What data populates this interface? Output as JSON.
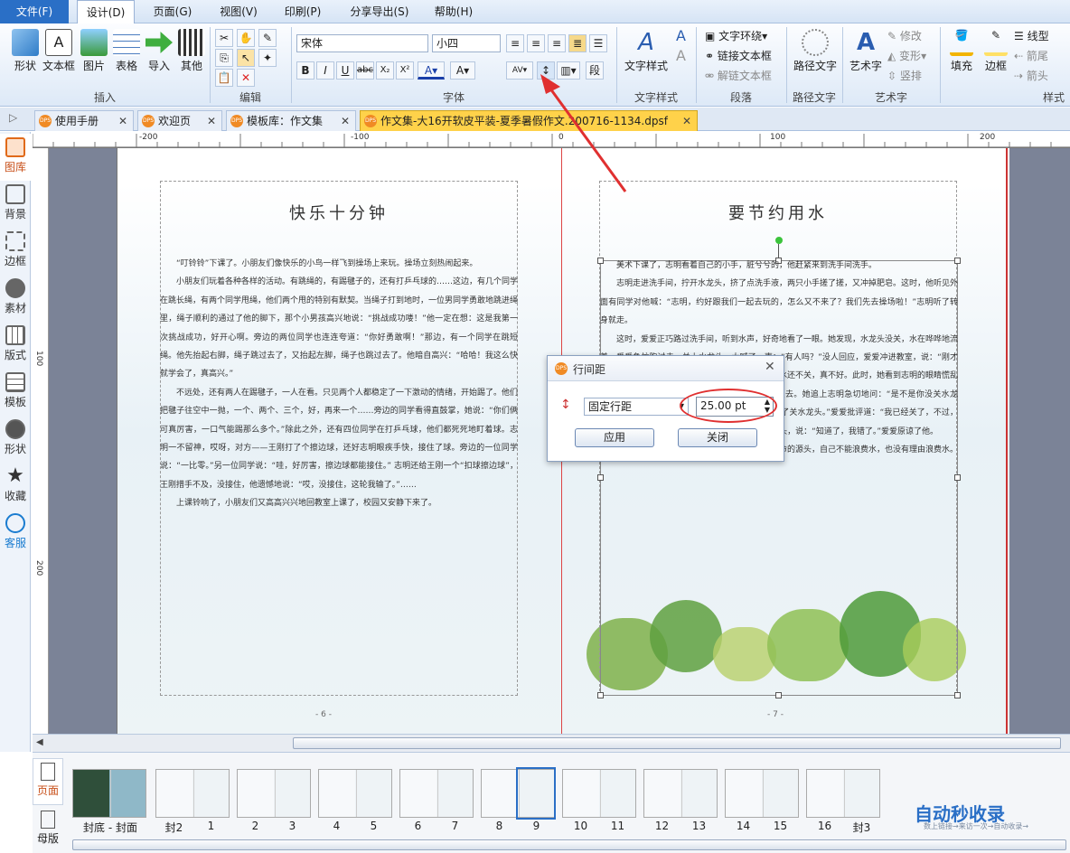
{
  "menu": [
    "文件(F)",
    "设计(D)",
    "页面(G)",
    "视图(V)",
    "印刷(P)",
    "分享导出(S)",
    "帮助(H)"
  ],
  "ribbon": {
    "insert": {
      "buttons": [
        "形状",
        "文本框",
        "图片",
        "表格",
        "导入",
        "其他"
      ],
      "label": "插入"
    },
    "edit": {
      "label": "编辑"
    },
    "font": {
      "family": "宋体",
      "size": "小四",
      "label": "字体"
    },
    "text_style": {
      "button": "文字样式",
      "label": "文字样式"
    },
    "paragraph": {
      "items": [
        "文字环绕",
        "链接文本框",
        "解链文本框"
      ],
      "label": "段落"
    },
    "path_text": {
      "button": "路径文字",
      "label": "路径文字"
    },
    "art_text": {
      "button": "艺术字",
      "items": [
        "修改",
        "变形",
        "竖排"
      ],
      "label": "艺术字"
    },
    "style": {
      "buttons": [
        "填充",
        "边框"
      ],
      "items": [
        "线型",
        "箭尾",
        "箭头"
      ],
      "label": "样式"
    }
  },
  "tabs": [
    {
      "label": "使用手册"
    },
    {
      "label": "欢迎页"
    },
    {
      "label": "模板库：作文集"
    },
    {
      "label": "作文集-大16开软皮平装-夏季暑假作文.200716-1134.dpsf"
    }
  ],
  "sidebar": [
    "图库",
    "背景",
    "边框",
    "素材",
    "版式",
    "模板",
    "形状",
    "收藏",
    "客服"
  ],
  "ruler": {
    "h": [
      "-200",
      "-100",
      "0",
      "100",
      "200"
    ],
    "v": [
      "100",
      "200"
    ]
  },
  "pages": {
    "left": {
      "title": "快乐十分钟",
      "paragraphs": [
        "“叮铃铃”下课了。小朋友们像快乐的小鸟一样飞到操场上来玩。操场立刻热闹起来。",
        "小朋友们玩着各种各样的活动。有跳绳的，有踢毽子的，还有打乒乓球的……这边，有几个同学在跳长绳，有两个同学甩绳，他们两个甩的特别有默契。当绳子打到地时，一位男同学勇敢地跳进绳里，绳子顺利的通过了他的脚下，那个小男孩高兴地说：“挑战成功喽！”他一定在想：这是我第一次挑战成功，好开心啊。旁边的两位同学也连连夸道：“你好勇敢啊！”那边，有一个同学在跳短绳。他先抬起右脚，绳子跳过去了，又抬起左脚，绳子也跳过去了。他暗自高兴：“哈哈！我这么快就学会了，真高兴。”",
        "不远处，还有两人在踢毽子，一人在看。只见两个人都稳定了一下激动的情绪，开始踢了。他们把毽子往空中一抛，一个、两个、三个，好，再来一个……旁边的同学看得直鼓掌，她说：“你们俩可真厉害，一口气能踢那么多个。”除此之外，还有四位同学在打乒乓球，他们都死死地盯着球。志明一不留神，哎呀，对方——王刚打了个擦边球，还好志明眼疾手快，接住了球。旁边的一位同学说：“一比零。”另一位同学说：“哇，好厉害，擦边球都能接住。” 志明还给王刚一个“扣球擦边球”，王刚措手不及，没接住，他遗憾地说：“哎，没接住，这轮我输了。”……",
        "上课铃响了，小朋友们又高高兴兴地回教室上课了，校园又安静下来了。"
      ],
      "page_number": "- 6 -"
    },
    "right": {
      "title": "要节约用水",
      "paragraphs": [
        "美术下课了，志明看着自己的小手，脏兮兮的，他赶紧来到洗手间洗手。",
        "志明走进洗手间，拧开水龙头，挤了点洗手液，两只小手搓了搓，又冲掉肥皂。这时，他听见外面有同学对他喊：“志明，约好跟我们一起去玩的，怎么又不来了？我们先去操场啦！”志明听了转身就走。",
        "这时，爱爱正巧路过洗手间，听到水声，好奇地看了一眼。她发现，水龙头没关，水在哗哗地流着。爱爱急忙跑过去，关上水龙头，大喊了一声：“有人吗？”没人回应，爱爱冲进教室，说：“刚才谁在洗手间洗手？水龙头都没关，太浪费水，用了水还不关，真不好。此时，她看到志明的眼睛慌乱了一下，她心想：难道是志明？于是，爱爱追了上去。她追上志明急切地问：“是不是你没关水龙头？”志明一拍脑门，说：“我这个粗心大王，又忘了关水龙头。”爱爱批评道：“我已经关了，不过，以后不能再这样了，要节约用水。”志明一个劲地点头，说：“知道了，我错了。”爱爱原谅了他。",
        "从此，志明不再浪费水了，因为他知道水是生命的源头，自己不能浪费水，也没有理由浪费水。"
      ],
      "page_number": "- 7 -"
    }
  },
  "dialog": {
    "title": "行间距",
    "mode": "固定行距",
    "value": "25.00 pt",
    "apply": "应用",
    "close": "关闭"
  },
  "thumbnails": {
    "side_tabs": [
      "页面",
      "母版"
    ],
    "labels": [
      "封底 - 封面",
      "封2",
      "1",
      "2",
      "3",
      "4",
      "5",
      "6",
      "7",
      "8",
      "9",
      "10",
      "11",
      "12",
      "13",
      "14",
      "15",
      "16",
      "封3"
    ],
    "selected": "9"
  },
  "watermark": {
    "title": "自动秒收录",
    "subtitle": "数上链接→来访一次→自动收录→"
  },
  "colors": {
    "accent": "#2a6fc6",
    "dialog_highlight": "#e03030",
    "arrow": "#e03030"
  }
}
